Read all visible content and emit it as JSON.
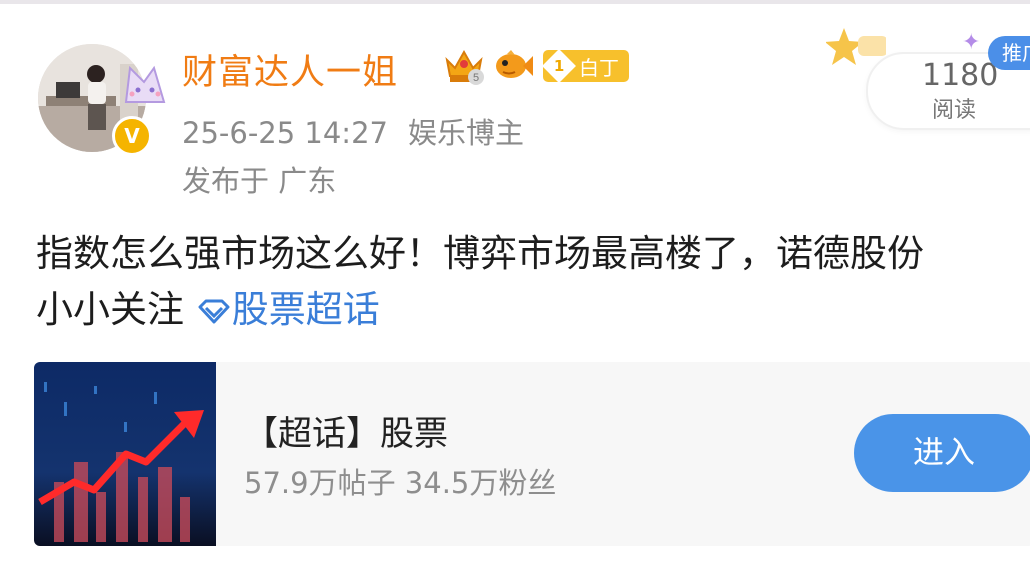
{
  "post": {
    "username": "财富达人一姐",
    "crown_level": "5",
    "level_badge": {
      "number": "1",
      "label": "白丁"
    },
    "date": "25-6-25 14:27",
    "user_tag": "娱乐博主",
    "location": "发布于 广东",
    "text_line1": "指数怎么强市场这么好！博弈市场最高楼了，诺德股份",
    "text_line2_prefix": "小小关注 ",
    "topic_link": "股票超话"
  },
  "reads": {
    "count": "1180",
    "label": "阅读",
    "push_tag": "推广"
  },
  "card": {
    "title": "【超话】股票",
    "stats": "57.9万帖子 34.5万粉丝",
    "button": "进入"
  },
  "icons": {
    "avatar": "avatar",
    "verified": "verified-v-icon",
    "crown": "crown-icon",
    "fish": "fish-icon",
    "level": "diamond-level-icon",
    "topic": "diamond-topic-icon",
    "star": "star-deco-icon"
  },
  "colors": {
    "username": "#f07c14",
    "link": "#3a7ed8",
    "button": "#4a94e8",
    "meta": "#8a8a8a"
  }
}
